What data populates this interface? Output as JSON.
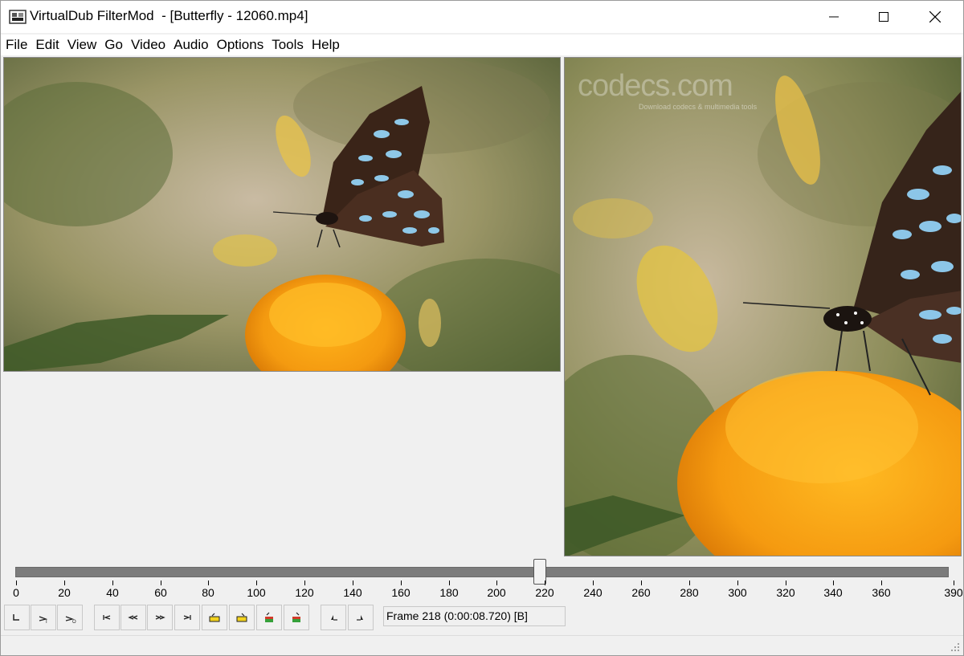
{
  "window": {
    "title": "VirtualDub FilterMod  - [Butterfly - 12060.mp4]",
    "controls": {
      "minimize": "—",
      "maximize": "☐",
      "close": "✕"
    }
  },
  "menu": [
    {
      "label": "File"
    },
    {
      "label": "Edit"
    },
    {
      "label": "View"
    },
    {
      "label": "Go"
    },
    {
      "label": "Video"
    },
    {
      "label": "Audio"
    },
    {
      "label": "Options"
    },
    {
      "label": "Tools"
    },
    {
      "label": "Help"
    }
  ],
  "panes": {
    "input": {
      "content": "butterfly on marigold"
    },
    "output": {
      "content": "butterfly on marigold (zoomed)",
      "watermark": "codecs.com",
      "watermark_sub": "Download codecs & multimedia tools"
    }
  },
  "timeline": {
    "min": 0,
    "max": 390,
    "current_frame": 218,
    "labels": [
      "0",
      "20",
      "40",
      "60",
      "80",
      "100",
      "120",
      "140",
      "160",
      "180",
      "200",
      "220",
      "240",
      "260",
      "280",
      "300",
      "320",
      "340",
      "360",
      "390"
    ]
  },
  "toolbar": {
    "buttons": [
      {
        "name": "stop-icon"
      },
      {
        "name": "play-input-icon"
      },
      {
        "name": "play-output-icon"
      },
      {
        "name": "go-start-icon"
      },
      {
        "name": "prev-frame-icon"
      },
      {
        "name": "next-frame-icon"
      },
      {
        "name": "go-end-icon"
      },
      {
        "name": "prev-keyframe-icon"
      },
      {
        "name": "next-keyframe-icon"
      },
      {
        "name": "scene-back-icon"
      },
      {
        "name": "scene-forward-icon"
      },
      {
        "name": "mark-in-icon"
      },
      {
        "name": "mark-out-icon"
      }
    ],
    "frame_status": "Frame 218 (0:00:08.720) [B]"
  },
  "colors": {
    "accent_yellow": "#f2d21e",
    "track": "#7c7c7c"
  }
}
